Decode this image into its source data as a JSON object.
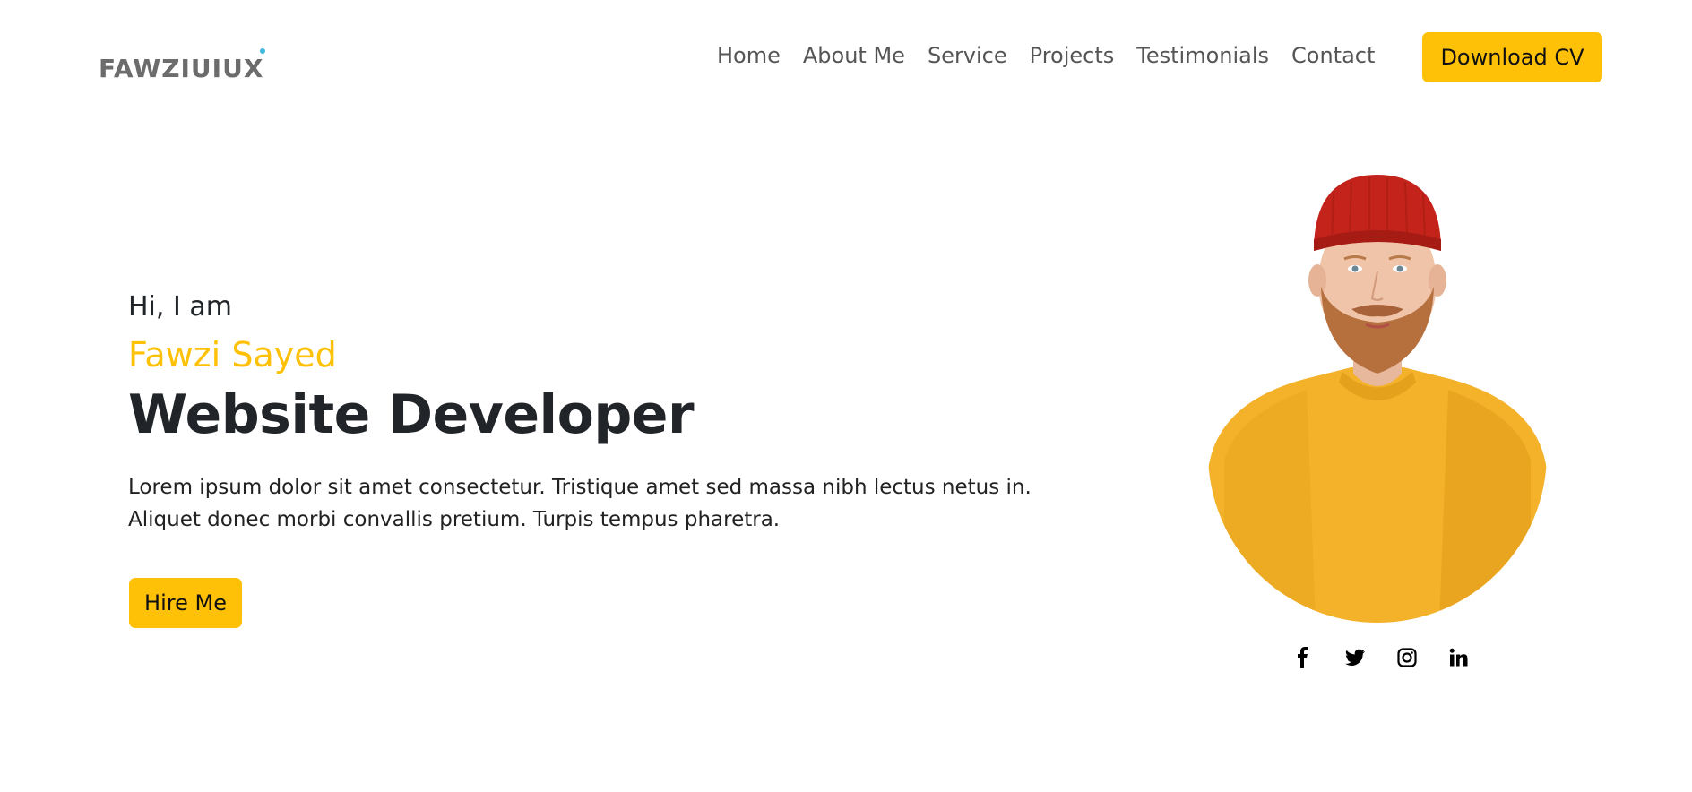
{
  "brand": {
    "logo_text": "FAWZIUIUX",
    "accent_dot_color": "#3fb8e0"
  },
  "nav": {
    "items": [
      {
        "label": "Home"
      },
      {
        "label": "About Me"
      },
      {
        "label": "Service"
      },
      {
        "label": "Projects"
      },
      {
        "label": "Testimonials"
      },
      {
        "label": "Contact"
      }
    ],
    "cta_label": "Download CV"
  },
  "hero": {
    "greeting": "Hi, I am",
    "name": "Fawzi Sayed",
    "role": "Website Developer",
    "description": "Lorem ipsum dolor sit amet consectetur. Tristique amet sed massa nibh lectus netus in. Aliquet donec morbi convallis pretium. Turpis tempus pharetra.",
    "cta_label": "Hire Me"
  },
  "socials": [
    {
      "icon": "facebook-icon"
    },
    {
      "icon": "twitter-icon"
    },
    {
      "icon": "instagram-icon"
    },
    {
      "icon": "linkedin-icon"
    }
  ],
  "colors": {
    "accent": "#ffc107",
    "heading": "#212529",
    "nav_text": "#555555",
    "logo": "#6c6c6c"
  }
}
